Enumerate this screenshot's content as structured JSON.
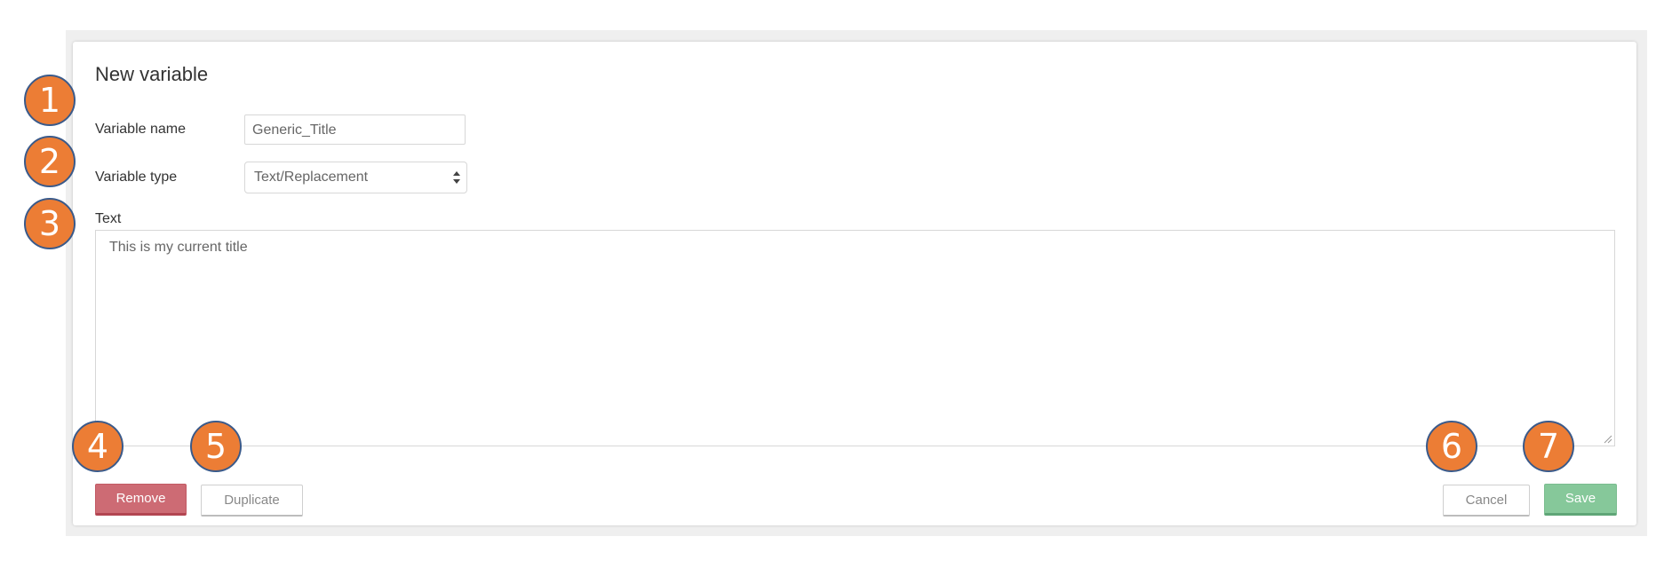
{
  "dialog": {
    "title": "New variable",
    "fields": {
      "name_label": "Variable name",
      "name_value": "Generic_Title",
      "type_label": "Variable type",
      "type_value": "Text/Replacement",
      "text_label": "Text",
      "text_value": "This is my current title"
    },
    "buttons": {
      "remove": "Remove",
      "duplicate": "Duplicate",
      "cancel": "Cancel",
      "save": "Save"
    }
  },
  "markers": [
    "1",
    "2",
    "3",
    "4",
    "5",
    "6",
    "7"
  ],
  "colors": {
    "marker": "#ec7d35",
    "marker_border": "#3a5a8a",
    "remove": "#cd6b74",
    "save": "#86c89a"
  }
}
